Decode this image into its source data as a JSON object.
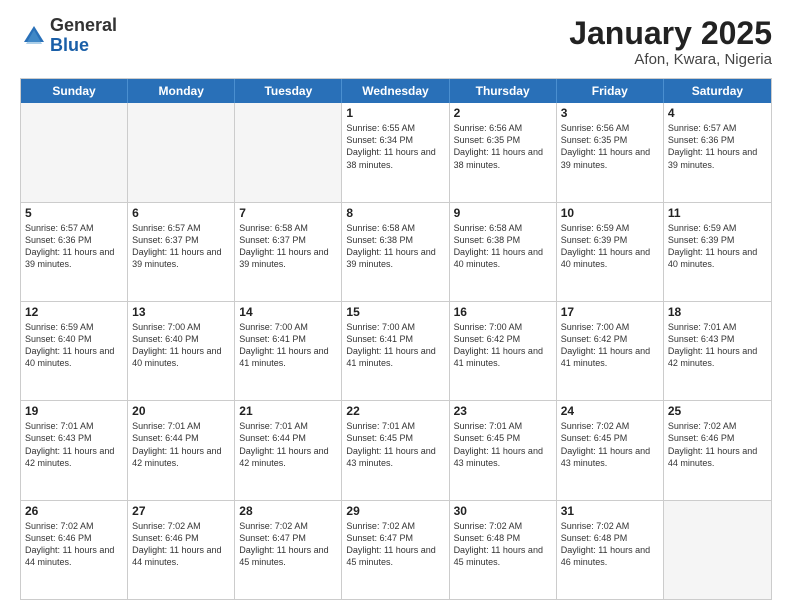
{
  "logo": {
    "general": "General",
    "blue": "Blue"
  },
  "title": "January 2025",
  "subtitle": "Afon, Kwara, Nigeria",
  "header_days": [
    "Sunday",
    "Monday",
    "Tuesday",
    "Wednesday",
    "Thursday",
    "Friday",
    "Saturday"
  ],
  "weeks": [
    [
      {
        "day": "",
        "info": "",
        "empty": true
      },
      {
        "day": "",
        "info": "",
        "empty": true
      },
      {
        "day": "",
        "info": "",
        "empty": true
      },
      {
        "day": "1",
        "info": "Sunrise: 6:55 AM\nSunset: 6:34 PM\nDaylight: 11 hours\nand 38 minutes."
      },
      {
        "day": "2",
        "info": "Sunrise: 6:56 AM\nSunset: 6:35 PM\nDaylight: 11 hours\nand 38 minutes."
      },
      {
        "day": "3",
        "info": "Sunrise: 6:56 AM\nSunset: 6:35 PM\nDaylight: 11 hours\nand 39 minutes."
      },
      {
        "day": "4",
        "info": "Sunrise: 6:57 AM\nSunset: 6:36 PM\nDaylight: 11 hours\nand 39 minutes."
      }
    ],
    [
      {
        "day": "5",
        "info": "Sunrise: 6:57 AM\nSunset: 6:36 PM\nDaylight: 11 hours\nand 39 minutes."
      },
      {
        "day": "6",
        "info": "Sunrise: 6:57 AM\nSunset: 6:37 PM\nDaylight: 11 hours\nand 39 minutes."
      },
      {
        "day": "7",
        "info": "Sunrise: 6:58 AM\nSunset: 6:37 PM\nDaylight: 11 hours\nand 39 minutes."
      },
      {
        "day": "8",
        "info": "Sunrise: 6:58 AM\nSunset: 6:38 PM\nDaylight: 11 hours\nand 39 minutes."
      },
      {
        "day": "9",
        "info": "Sunrise: 6:58 AM\nSunset: 6:38 PM\nDaylight: 11 hours\nand 40 minutes."
      },
      {
        "day": "10",
        "info": "Sunrise: 6:59 AM\nSunset: 6:39 PM\nDaylight: 11 hours\nand 40 minutes."
      },
      {
        "day": "11",
        "info": "Sunrise: 6:59 AM\nSunset: 6:39 PM\nDaylight: 11 hours\nand 40 minutes."
      }
    ],
    [
      {
        "day": "12",
        "info": "Sunrise: 6:59 AM\nSunset: 6:40 PM\nDaylight: 11 hours\nand 40 minutes."
      },
      {
        "day": "13",
        "info": "Sunrise: 7:00 AM\nSunset: 6:40 PM\nDaylight: 11 hours\nand 40 minutes."
      },
      {
        "day": "14",
        "info": "Sunrise: 7:00 AM\nSunset: 6:41 PM\nDaylight: 11 hours\nand 41 minutes."
      },
      {
        "day": "15",
        "info": "Sunrise: 7:00 AM\nSunset: 6:41 PM\nDaylight: 11 hours\nand 41 minutes."
      },
      {
        "day": "16",
        "info": "Sunrise: 7:00 AM\nSunset: 6:42 PM\nDaylight: 11 hours\nand 41 minutes."
      },
      {
        "day": "17",
        "info": "Sunrise: 7:00 AM\nSunset: 6:42 PM\nDaylight: 11 hours\nand 41 minutes."
      },
      {
        "day": "18",
        "info": "Sunrise: 7:01 AM\nSunset: 6:43 PM\nDaylight: 11 hours\nand 42 minutes."
      }
    ],
    [
      {
        "day": "19",
        "info": "Sunrise: 7:01 AM\nSunset: 6:43 PM\nDaylight: 11 hours\nand 42 minutes."
      },
      {
        "day": "20",
        "info": "Sunrise: 7:01 AM\nSunset: 6:44 PM\nDaylight: 11 hours\nand 42 minutes."
      },
      {
        "day": "21",
        "info": "Sunrise: 7:01 AM\nSunset: 6:44 PM\nDaylight: 11 hours\nand 42 minutes."
      },
      {
        "day": "22",
        "info": "Sunrise: 7:01 AM\nSunset: 6:45 PM\nDaylight: 11 hours\nand 43 minutes."
      },
      {
        "day": "23",
        "info": "Sunrise: 7:01 AM\nSunset: 6:45 PM\nDaylight: 11 hours\nand 43 minutes."
      },
      {
        "day": "24",
        "info": "Sunrise: 7:02 AM\nSunset: 6:45 PM\nDaylight: 11 hours\nand 43 minutes."
      },
      {
        "day": "25",
        "info": "Sunrise: 7:02 AM\nSunset: 6:46 PM\nDaylight: 11 hours\nand 44 minutes."
      }
    ],
    [
      {
        "day": "26",
        "info": "Sunrise: 7:02 AM\nSunset: 6:46 PM\nDaylight: 11 hours\nand 44 minutes."
      },
      {
        "day": "27",
        "info": "Sunrise: 7:02 AM\nSunset: 6:46 PM\nDaylight: 11 hours\nand 44 minutes."
      },
      {
        "day": "28",
        "info": "Sunrise: 7:02 AM\nSunset: 6:47 PM\nDaylight: 11 hours\nand 45 minutes."
      },
      {
        "day": "29",
        "info": "Sunrise: 7:02 AM\nSunset: 6:47 PM\nDaylight: 11 hours\nand 45 minutes."
      },
      {
        "day": "30",
        "info": "Sunrise: 7:02 AM\nSunset: 6:48 PM\nDaylight: 11 hours\nand 45 minutes."
      },
      {
        "day": "31",
        "info": "Sunrise: 7:02 AM\nSunset: 6:48 PM\nDaylight: 11 hours\nand 46 minutes."
      },
      {
        "day": "",
        "info": "",
        "empty": true
      }
    ]
  ]
}
